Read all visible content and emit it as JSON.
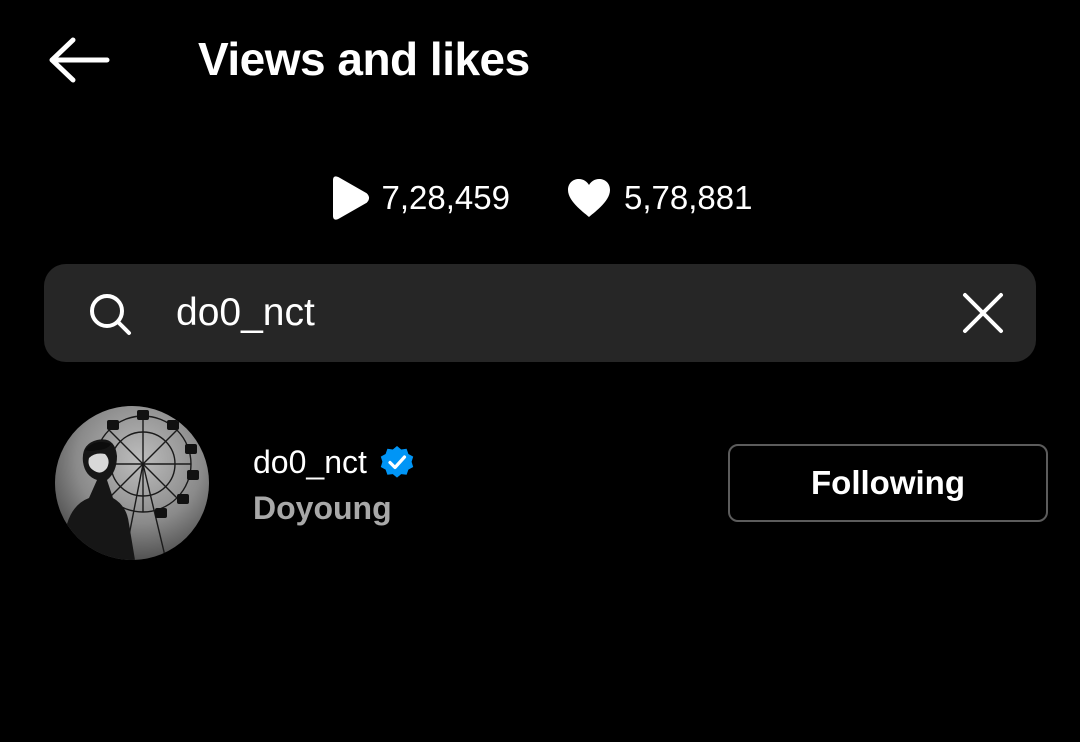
{
  "header": {
    "back_icon": "arrow-left-icon",
    "title": "Views and likes"
  },
  "stats": {
    "views": {
      "icon": "play-icon",
      "value": "7,28,459"
    },
    "likes": {
      "icon": "heart-icon",
      "value": "5,78,881"
    }
  },
  "search": {
    "icon": "search-icon",
    "value": "do0_nct",
    "clear_icon": "close-icon"
  },
  "results": [
    {
      "username": "do0_nct",
      "verified": true,
      "full_name": "Doyoung",
      "follow_label": "Following"
    }
  ],
  "colors": {
    "background": "#000000",
    "search_background": "#262626",
    "secondary_text": "#a8a8a8",
    "verified_blue": "#0095f6",
    "button_border": "#5c5c5c"
  }
}
